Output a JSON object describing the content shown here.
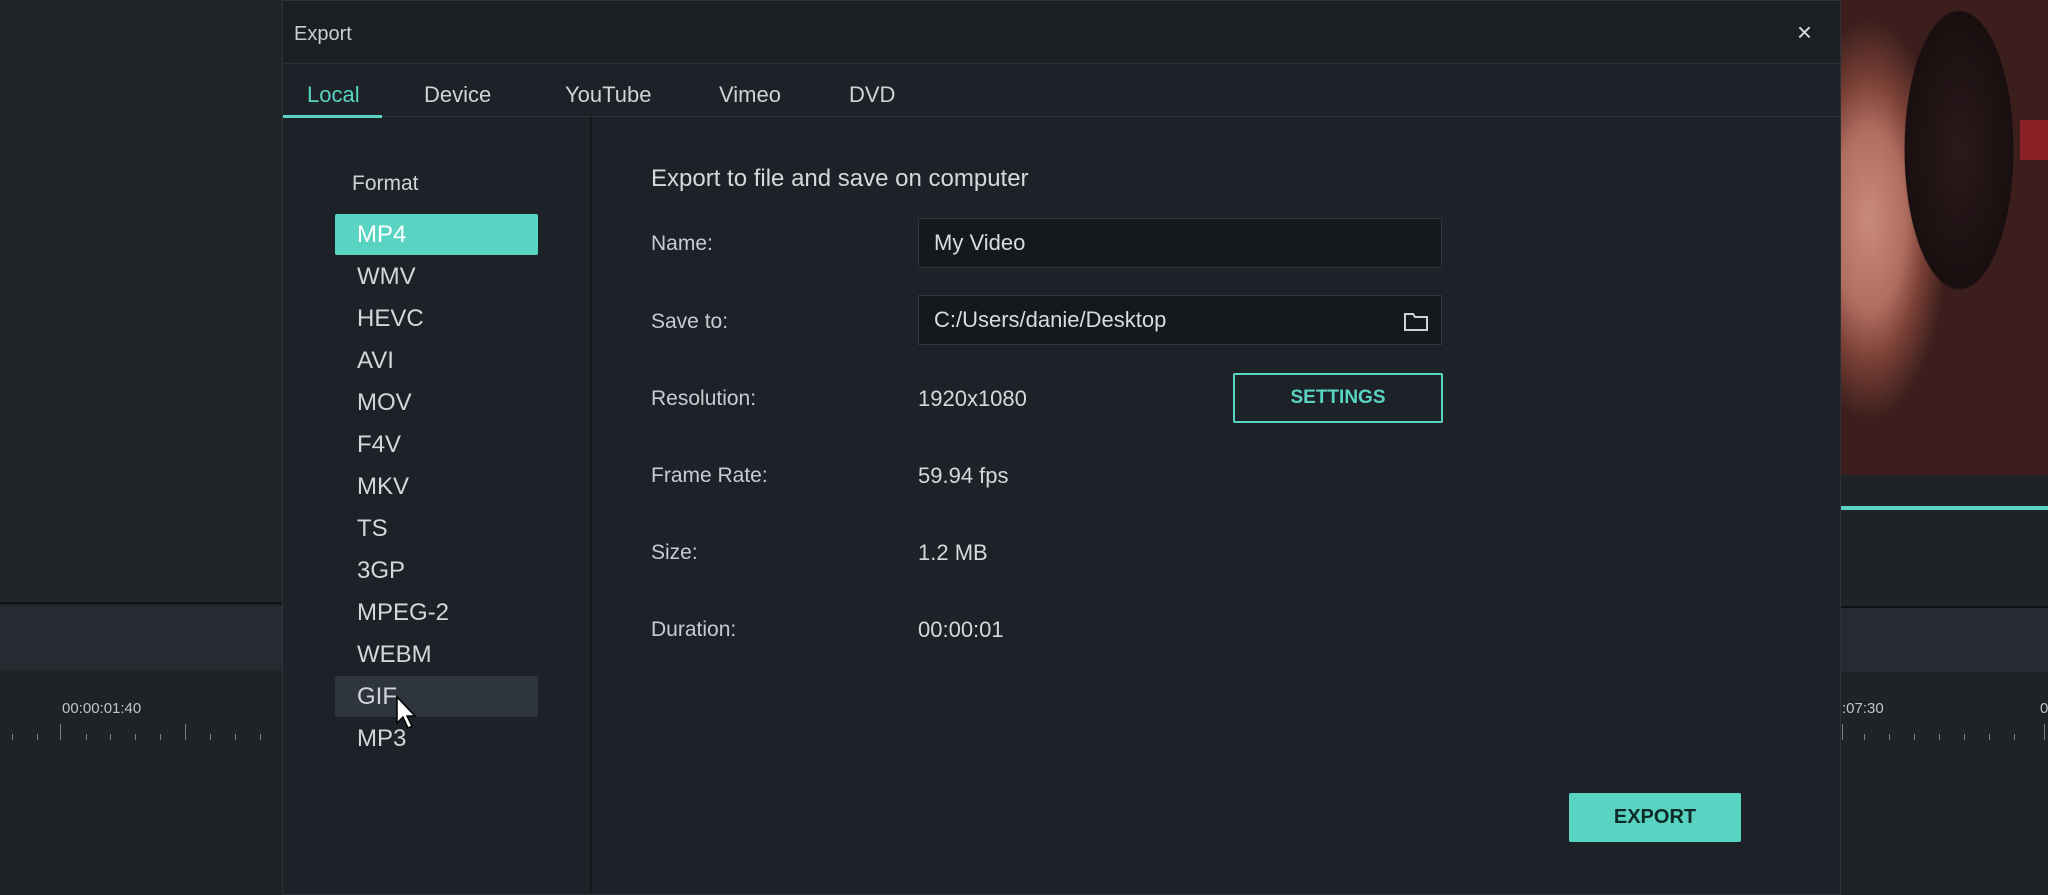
{
  "dialog": {
    "title": "Export",
    "close_glyph": "×"
  },
  "tabs": [
    {
      "label": "Local",
      "active": true
    },
    {
      "label": "Device",
      "active": false
    },
    {
      "label": "YouTube",
      "active": false
    },
    {
      "label": "Vimeo",
      "active": false
    },
    {
      "label": "DVD",
      "active": false
    }
  ],
  "sidebar": {
    "format_label": "Format",
    "formats": [
      "MP4",
      "WMV",
      "HEVC",
      "AVI",
      "MOV",
      "F4V",
      "MKV",
      "TS",
      "3GP",
      "MPEG-2",
      "WEBM",
      "GIF",
      "MP3"
    ],
    "selected": "MP4",
    "hovered": "GIF"
  },
  "main": {
    "heading": "Export to file and save on computer",
    "name_label": "Name:",
    "name_value": "My Video",
    "save_to_label": "Save to:",
    "save_to_value": "C:/Users/danie/Desktop",
    "resolution_label": "Resolution:",
    "resolution_value": "1920x1080",
    "settings_label": "SETTINGS",
    "frame_rate_label": "Frame Rate:",
    "frame_rate_value": "59.94 fps",
    "size_label": "Size:",
    "size_value": "1.2 MB",
    "duration_label": "Duration:",
    "duration_value": "00:00:01",
    "export_label": "EXPORT"
  },
  "timeline": {
    "left_time": "00:00:01:40",
    "right_time": ":07:30",
    "right_time_2": "0"
  },
  "colors": {
    "accent": "#59d4c2",
    "dialog_bg": "#1d2228",
    "field_bg": "#15191d"
  },
  "icons": {
    "close": "close-icon",
    "folder": "folder-icon",
    "cursor": "mouse-pointer-icon"
  }
}
